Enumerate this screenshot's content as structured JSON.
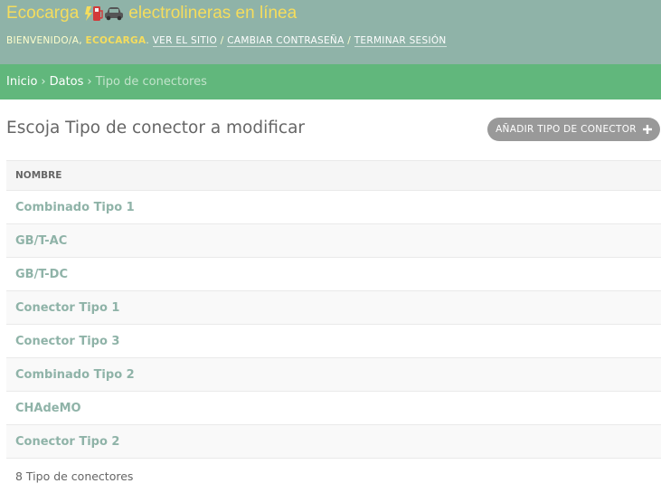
{
  "branding": {
    "name": "Ecocarga",
    "tagline": "electrolineras en línea",
    "icons": [
      "charging-station-icon",
      "car-icon"
    ]
  },
  "user_tools": {
    "welcome": "BIENVENIDO/A, ",
    "username": "ECOCARGA",
    "after_user": ". ",
    "view_site": "VER EL SITIO",
    "separator": " / ",
    "change_password": "CAMBIAR CONTRASEÑA",
    "logout": "TERMINAR SESIÓN"
  },
  "breadcrumbs": {
    "home": "Inicio",
    "app": "Datos",
    "current": "Tipo de conectores",
    "separator": "›"
  },
  "content": {
    "title": "Escoja Tipo de conector a modificar",
    "add_button": "AÑADIR TIPO DE CONECTOR"
  },
  "table": {
    "header": "NOMBRE",
    "rows": [
      "Combinado Tipo 1",
      "GB/T-AC",
      "GB/T-DC",
      "Conector Tipo 1",
      "Conector Tipo 3",
      "Combinado Tipo 2",
      "CHAdeMO",
      "Conector Tipo 2"
    ]
  },
  "paginator": "8 Tipo de conectores",
  "colors": {
    "header_bg": "#8fb3a8",
    "brand_text": "#f5dd5d",
    "breadcrumbs_bg": "#61b77c",
    "link": "#8fb3a8",
    "button_bg": "#999999"
  }
}
